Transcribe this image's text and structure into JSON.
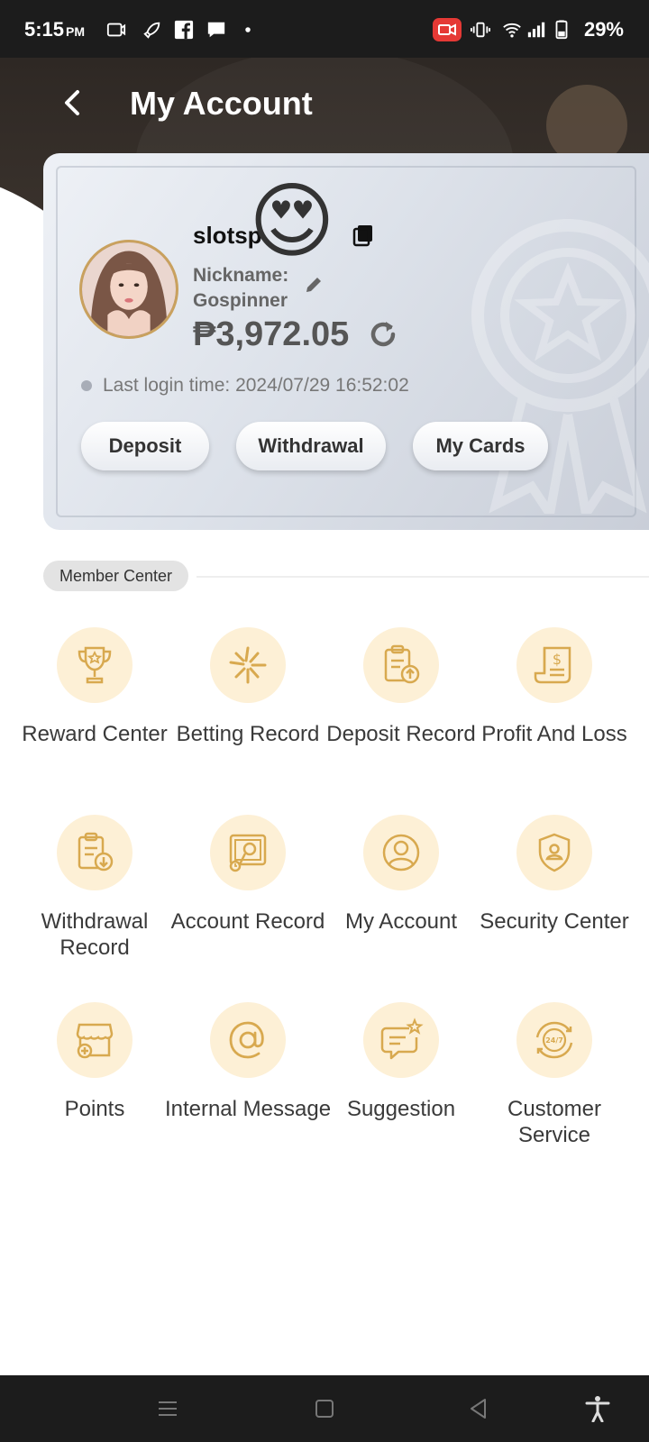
{
  "status_bar": {
    "time": "5:15",
    "ampm": "PM",
    "battery": "29%",
    "icons": [
      "screen-record-icon",
      "rocket-icon",
      "facebook-icon",
      "message-icon",
      "dot-icon",
      "video-record-icon",
      "vibrate-icon",
      "wifi-icon",
      "signal-icon",
      "battery-icon"
    ],
    "record_color": "#e53935"
  },
  "header": {
    "title": "My Account",
    "background": "#2e2824"
  },
  "profile": {
    "username": "slotsp",
    "emoji": "😍",
    "nickname_label": "Nickname:",
    "nickname": "Gospinner",
    "balance": "₱3,972.05",
    "last_login": "Last login time: 2024/07/29 16:52:02"
  },
  "actions": {
    "deposit": "Deposit",
    "withdrawal": "Withdrawal",
    "my_cards": "My Cards"
  },
  "member_center": {
    "title": "Member Center",
    "accent": "#d8a94f",
    "icon_bg": "#fdf0d6",
    "items": [
      {
        "label": "Reward Center",
        "icon": "trophy-icon"
      },
      {
        "label": "Betting Record",
        "icon": "sparkle-icon"
      },
      {
        "label": "Deposit Record",
        "icon": "clipboard-upload-icon"
      },
      {
        "label": "Profit And Loss",
        "icon": "receipt-dollar-icon"
      },
      {
        "label": "Withdrawal Record",
        "icon": "clipboard-download-icon"
      },
      {
        "label": "Account Record",
        "icon": "account-record-icon"
      },
      {
        "label": "My Account",
        "icon": "user-icon"
      },
      {
        "label": "Security Center",
        "icon": "shield-user-icon"
      },
      {
        "label": "Points",
        "icon": "shop-icon"
      },
      {
        "label": "Internal Message",
        "icon": "at-icon"
      },
      {
        "label": "Suggestion",
        "icon": "chat-star-icon"
      },
      {
        "label": "Customer Service",
        "icon": "support-24-7-icon"
      }
    ],
    "badge_text": "24/7"
  },
  "nav_bar": {
    "icons": [
      "recent-apps-icon",
      "home-icon",
      "back-icon",
      "accessibility-icon"
    ]
  }
}
